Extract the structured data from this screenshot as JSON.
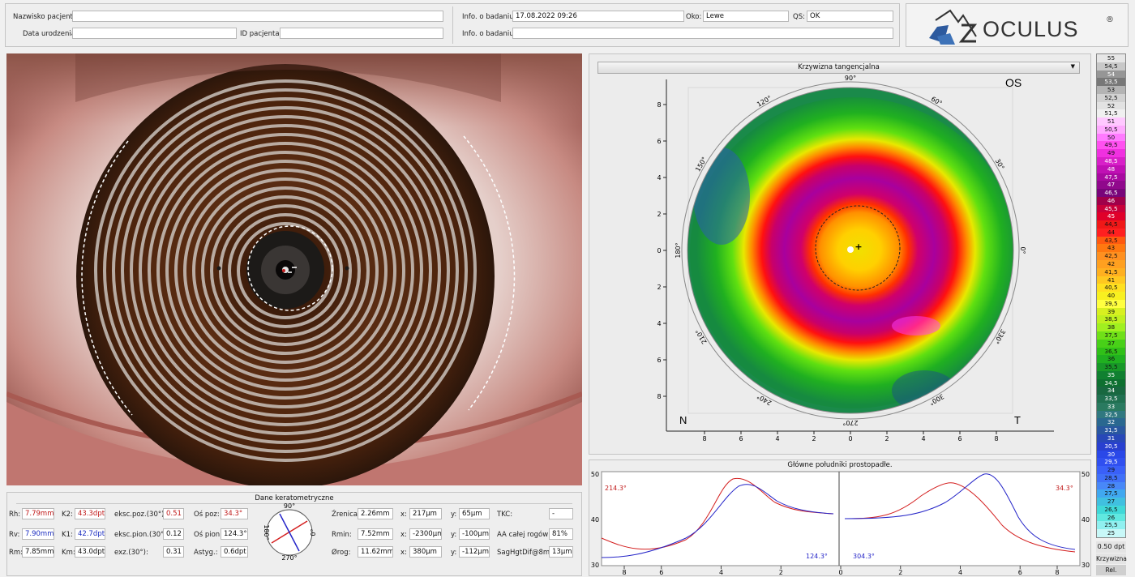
{
  "header": {
    "patient_name_label": "Nazwisko pacjenta:",
    "patient_name_value": "",
    "birth_label": "Data urodzenia:",
    "birth_value": "",
    "patient_id_label": "ID pacjenta:",
    "patient_id_value": "",
    "exam_info_label_1": "Info. o badaniu:",
    "exam_datetime": "17.08.2022 09:26",
    "eye_label": "Oko:",
    "eye_value": "Lewe",
    "qs_label": "QS:",
    "qs_value": "OK",
    "exam_info_label_2": "Info. o badaniu:",
    "exam_info_value_2": ""
  },
  "logo": {
    "text": "OCULUS",
    "registered": "®",
    "brand_color": "#3a5f9a"
  },
  "map": {
    "dropdown_value": "Krzywizna tangencjalna",
    "eye_side": "OS",
    "nasal": "N",
    "temporal": "T",
    "angle_labels": [
      {
        "a": 90,
        "t": "90°"
      },
      {
        "a": 60,
        "t": "60°"
      },
      {
        "a": 30,
        "t": "30°"
      },
      {
        "a": 0,
        "t": "0°"
      },
      {
        "a": 330,
        "t": "330°"
      },
      {
        "a": 300,
        "t": "300°"
      },
      {
        "a": 270,
        "t": "270°"
      },
      {
        "a": 240,
        "t": "240°"
      },
      {
        "a": 210,
        "t": "210°"
      },
      {
        "a": 180,
        "t": "180°"
      },
      {
        "a": 150,
        "t": "150°"
      },
      {
        "a": 120,
        "t": "120°"
      }
    ],
    "y_ticks": [
      "8",
      "6",
      "4",
      "2",
      "0",
      "2",
      "4",
      "6",
      "8"
    ],
    "x_ticks": [
      "8",
      "6",
      "4",
      "2",
      "0",
      "2",
      "4",
      "6",
      "8"
    ]
  },
  "scale": {
    "values": [
      "55",
      "54,5",
      "54",
      "53,5",
      "53",
      "52,5",
      "52",
      "51,5",
      "51",
      "50,5",
      "50",
      "49,5",
      "49",
      "48,5",
      "48",
      "47,5",
      "47",
      "46,5",
      "46",
      "45,5",
      "45",
      "44,5",
      "44",
      "43,5",
      "43",
      "42,5",
      "42",
      "41,5",
      "41",
      "40,5",
      "40",
      "39,5",
      "39",
      "38,5",
      "38",
      "37,5",
      "37",
      "36,5",
      "36",
      "35,5",
      "35",
      "34,5",
      "34",
      "33,5",
      "33",
      "32,5",
      "32",
      "31,5",
      "31",
      "30,5",
      "30",
      "29,5",
      "29",
      "28,5",
      "28",
      "27,5",
      "27",
      "26,5",
      "26",
      "25,5",
      "25"
    ],
    "step_label": "0.50 dpt",
    "type_label": "Krzywizna",
    "mode_label": "Rel."
  },
  "kerato": {
    "title": "Dane keratometryczne",
    "rh_label": "Rh:",
    "rh": "7.79mm",
    "k2_label": "K2:",
    "k2": "43.3dpt",
    "rv_label": "Rv:",
    "rv": "7.90mm",
    "k1_label": "K1:",
    "k1": "42.7dpt",
    "rm_label": "Rm:",
    "rm": "7.85mm",
    "km_label": "Km:",
    "km": "43.0dpt",
    "ekh_label": "eksc.poz.(30°):",
    "ekh": "0.51",
    "ekv_label": "eksc.pion.(30°):",
    "ekv": "0.12",
    "exz_label": "exz.(30°):",
    "exz": "0.31",
    "axh_label": "Oś poz:",
    "axh": "34.3°",
    "axv_label": "Oś pion:",
    "axv": "124.3°",
    "ast_label": "Astyg.:",
    "ast": "0.6dpt",
    "dial_90": "90°",
    "dial_180": "180°",
    "dial_0": "0°",
    "dial_270": "270°",
    "pupil_label": "Źrenica:",
    "pupil": "2.26mm",
    "pupil_x": "217µm",
    "pupil_y": "65µm",
    "rmin_label": "Rmin:",
    "rmin": "7.52mm",
    "rmin_x": "-2300µm",
    "rmin_y": "-100µm",
    "limbus_label": "Ørog:",
    "limbus": "11.62mm",
    "limbus_x": "380µm",
    "limbus_y": "-112µm",
    "x_label": "x:",
    "y_label": "y:",
    "tkc_label": "TKC:",
    "tkc": "-",
    "aa_label": "AA całej rogówki:",
    "aa": "81%",
    "sag_label": "SagHgtDif@8mm:",
    "sag": "13µm"
  },
  "meridians": {
    "title": "Główne południki prostopadłe.",
    "y_ticks": [
      "50",
      "40",
      "30"
    ],
    "x_ticks": [
      "8",
      "6",
      "4",
      "2",
      "0",
      "2",
      "4",
      "6",
      "8"
    ],
    "l_red": "214.3°",
    "l_blue": "124.3°",
    "r_blue": "304.3°",
    "r_red": "34.3°",
    "red_color": "#d42020",
    "blue_color": "#2424c8"
  }
}
